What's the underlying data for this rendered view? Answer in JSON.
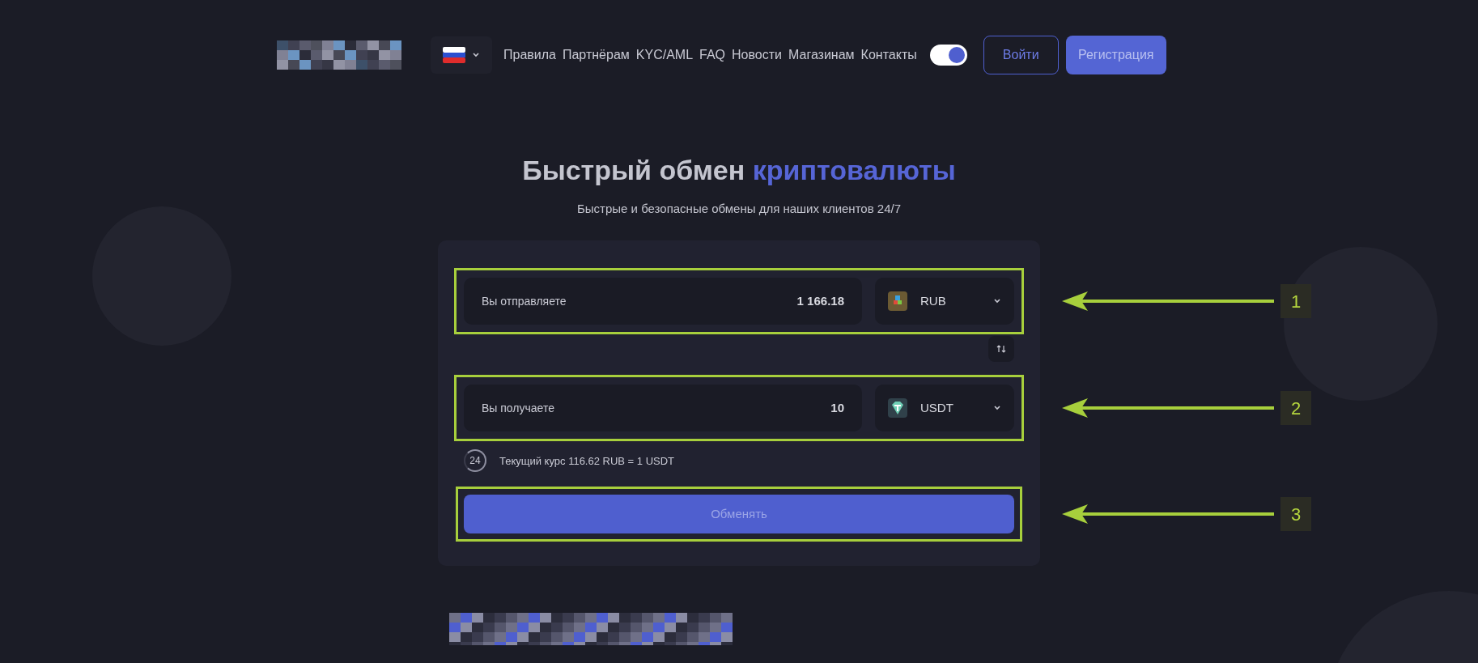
{
  "header": {
    "nav_links": [
      "Правила",
      "Партнёрам",
      "KYC/AML",
      "FAQ",
      "Новости",
      "Магазинам",
      "Контакты"
    ],
    "theme_toggle": {
      "on": true
    },
    "login_button": "Войти",
    "register_button": "Регистрация"
  },
  "hero": {
    "title_parts": [
      {
        "text": "Быстрый обмен",
        "accent": false
      },
      {
        "text": "криптовалюты",
        "accent": true
      }
    ],
    "subtitle": "Быстрые и безопасные обмены для наших клиентов 24/7"
  },
  "exchange": {
    "rows": [
      {
        "kind": "send",
        "label": "Вы отправляете",
        "amount": "1 166.18",
        "currency": "RUB",
        "callout": "1"
      },
      {
        "kind": "receive",
        "label": "Вы получаете",
        "amount": "10",
        "currency": "USDT",
        "callout": "2"
      }
    ],
    "timer": "24",
    "rate": "Текущий курс 116.62 RUB = 1 USDT",
    "submit": {
      "label": "Обменять",
      "callout": "3"
    }
  }
}
